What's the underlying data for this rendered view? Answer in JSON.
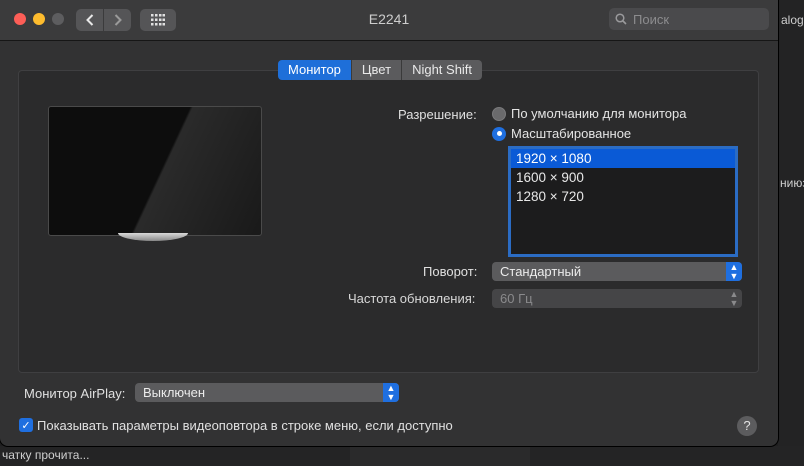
{
  "window": {
    "title": "E2241"
  },
  "search": {
    "placeholder": "Поиск"
  },
  "tabs": [
    {
      "label": "Монитор"
    },
    {
      "label": "Цвет"
    },
    {
      "label": "Night Shift"
    }
  ],
  "resolution": {
    "label": "Разрешение:",
    "option_default": "По умолчанию для монитора",
    "option_scaled": "Масштабированное",
    "selected_option": "Масштабированное",
    "list": [
      "1920 × 1080",
      "1600 × 900",
      "1280 × 720"
    ],
    "selected_value": "1920 × 1080"
  },
  "rotation": {
    "label": "Поворот:",
    "value": "Стандартный"
  },
  "refresh": {
    "label": "Частота обновления:",
    "value": "60 Гц"
  },
  "airplay": {
    "label": "Монитор AirPlay:",
    "value": "Выключен"
  },
  "mirroring_checkbox": {
    "label": "Показывать параметры видеоповтора в строке меню, если доступно",
    "checked": true
  },
  "help": {
    "label": "?"
  },
  "background_app": {
    "text_top": "alog",
    "text_mid": "ниюз",
    "text_bottom": "чатку прочита..."
  },
  "colors": {
    "accent": "#1f6fe0",
    "window_bg": "#323233"
  }
}
